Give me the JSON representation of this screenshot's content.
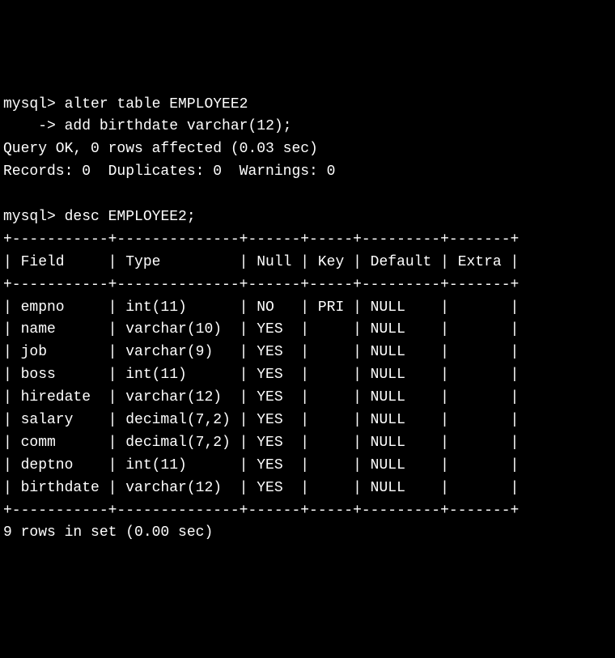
{
  "commands": {
    "prompt1": "mysql> ",
    "prompt2": "    -> ",
    "cmd1_line1": "alter table EMPLOYEE2",
    "cmd1_line2": "add birthdate varchar(12);",
    "result1_line1": "Query OK, 0 rows affected (0.03 sec)",
    "result1_line2": "Records: 0  Duplicates: 0  Warnings: 0",
    "cmd2": "desc EMPLOYEE2;"
  },
  "table": {
    "border_top": "+-----------+--------------+------+-----+---------+-------+",
    "header": "| Field     | Type         | Null | Key | Default | Extra |",
    "border_mid": "+-----------+--------------+------+-----+---------+-------+",
    "rows": [
      "| empno     | int(11)      | NO   | PRI | NULL    |       |",
      "| name      | varchar(10)  | YES  |     | NULL    |       |",
      "| job       | varchar(9)   | YES  |     | NULL    |       |",
      "| boss      | int(11)      | YES  |     | NULL    |       |",
      "| hiredate  | varchar(12)  | YES  |     | NULL    |       |",
      "| salary    | decimal(7,2) | YES  |     | NULL    |       |",
      "| comm      | decimal(7,2) | YES  |     | NULL    |       |",
      "| deptno    | int(11)      | YES  |     | NULL    |       |",
      "| birthdate | varchar(12)  | YES  |     | NULL    |       |"
    ],
    "border_bot": "+-----------+--------------+------+-----+---------+-------+",
    "footer": "9 rows in set (0.00 sec)"
  }
}
